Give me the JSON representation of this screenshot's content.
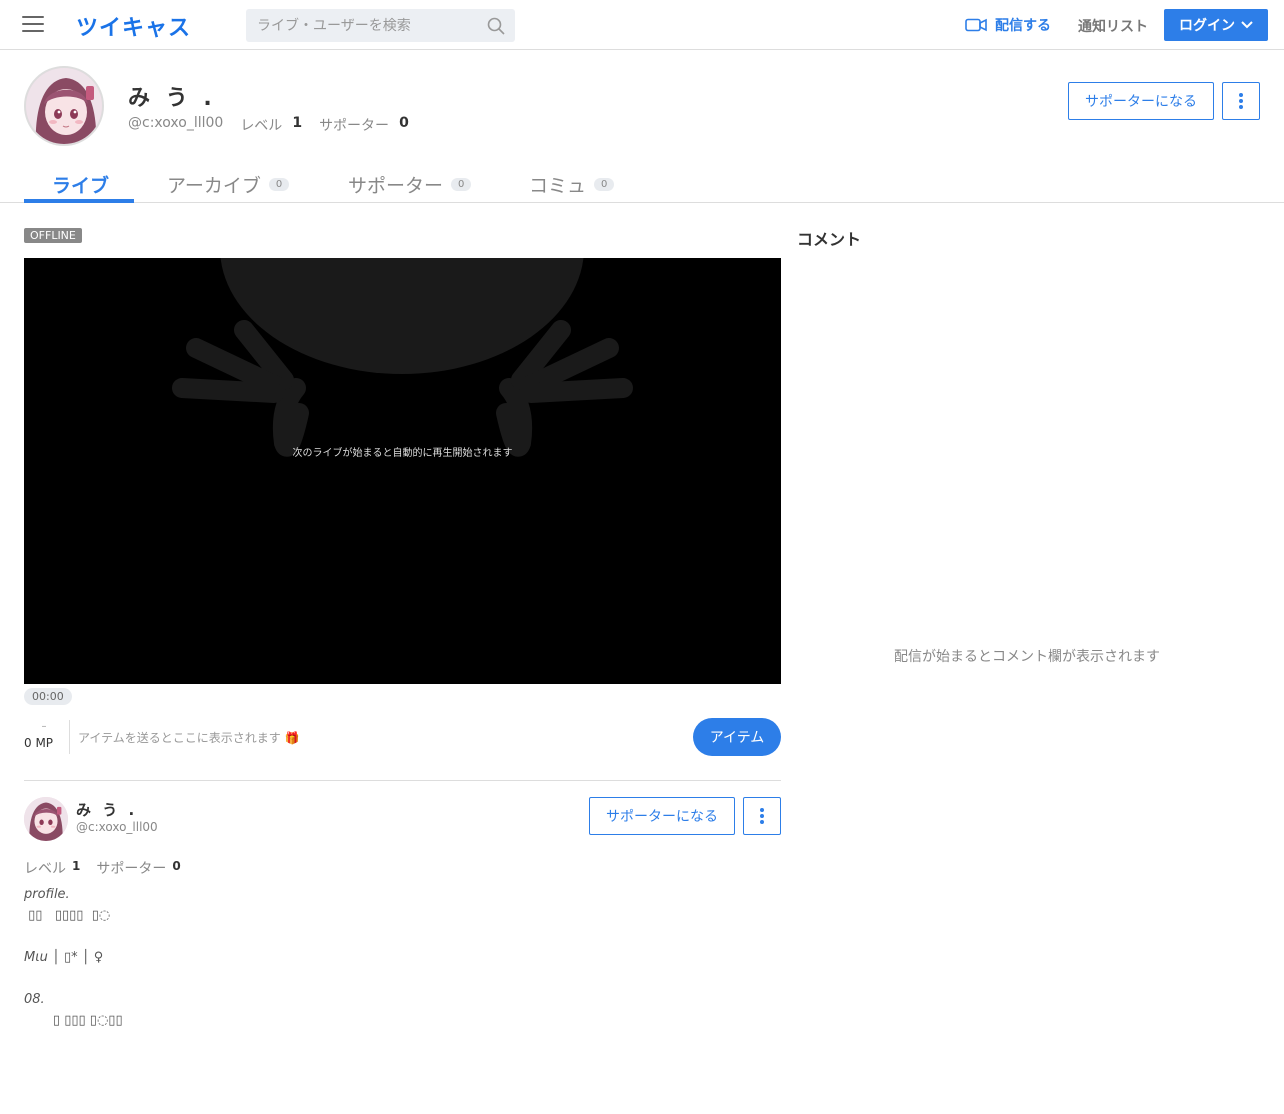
{
  "header": {
    "logo": "ツイキャス",
    "search_placeholder": "ライブ・ユーザーを検索",
    "broadcast_label": "配信する",
    "notify_label": "通知リスト",
    "login_label": "ログイン"
  },
  "profile": {
    "name": "み う .",
    "handle": "@c:xoxo_lll00",
    "level_label": "レベル",
    "level_value": "1",
    "supporter_label": "サポーター",
    "supporter_value": "0",
    "become_supporter": "サポーターになる"
  },
  "tabs": [
    {
      "label": "ライブ",
      "count": ""
    },
    {
      "label": "アーカイブ",
      "count": "0"
    },
    {
      "label": "サポーター",
      "count": "0"
    },
    {
      "label": "コミュ",
      "count": "0"
    }
  ],
  "live": {
    "status_badge": "OFFLINE",
    "player_message": "次のライブが始まると自動的に再生開始されます",
    "timer": "00:00",
    "mp_dash": "–",
    "mp_value": "0 MP",
    "item_message": "アイテムを送るとここに表示されます 🎁",
    "item_button": "アイテム"
  },
  "card": {
    "name": "み う .",
    "handle": "@c:xoxo_lll00",
    "level_label": "レベル",
    "level_value": "1",
    "supporter_label": "サポーター",
    "supporter_value": "0",
    "become_supporter": "サポーターになる",
    "bio": "profile.\n ▯▯   ▯▯▯▯  ▯◌\n\nMιu │ ▯* │ ♀\n\n08.\n       ▯ ▯▯▯ ▯◌▯▯"
  },
  "comments": {
    "title": "コメント",
    "empty_message": "配信が始まるとコメント欄が表示されます"
  },
  "colors": {
    "accent": "#2d7ee8",
    "offline_badge": "#888888"
  }
}
